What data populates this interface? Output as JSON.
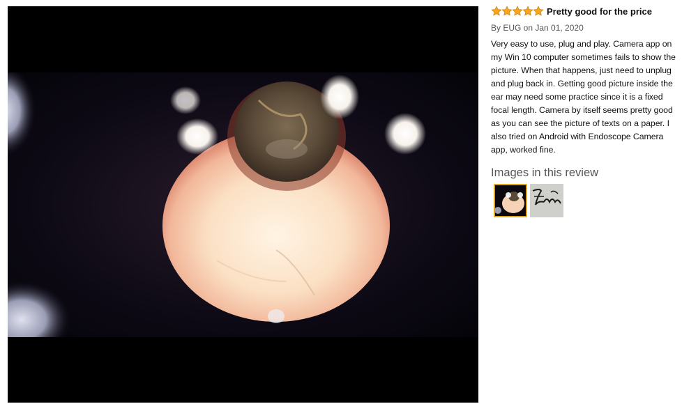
{
  "review": {
    "rating": 5,
    "rating_max": 5,
    "title": "Pretty good for the price",
    "byline": "By EUG on Jan 01, 2020",
    "body": "Very easy to use, plug and play. Camera app on my Win 10 computer sometimes fails to show the picture. When that happens, just need to unplug and plug back in. Getting good picture inside the ear may need some practice since it is a fixed focal length. Camera by itself seems pretty good as you can see the picture of texts on a paper. I also tried on Android with Endoscope Camera app, worked fine."
  },
  "images_section": {
    "heading": "Images in this review",
    "thumbnails": [
      {
        "icon": "ear-canal-photo",
        "selected": true
      },
      {
        "icon": "handwriting-photo",
        "selected": false
      }
    ]
  },
  "colors": {
    "star_fill": "#f5a623",
    "star_stroke": "#d08b10",
    "selected_border": "#e3a317",
    "viewer_background": "#000000"
  }
}
